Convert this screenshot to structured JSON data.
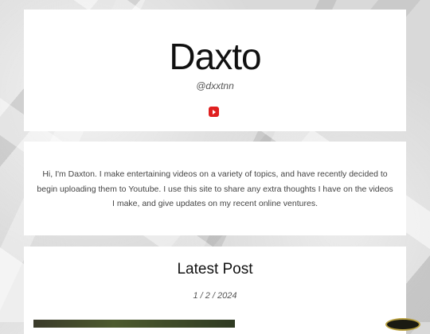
{
  "header": {
    "title": "Daxto",
    "handle": "@dxxtnn",
    "social_icon": "youtube-icon"
  },
  "about": {
    "text": "Hi, I'm Daxton. I make entertaining videos on a variety of topics, and have recently decided to begin uploading them to Youtube. I use this site to share any extra thoughts I have on the videos I make, and give updates on my recent online ventures."
  },
  "latest_post": {
    "heading": "Latest Post",
    "date": "1 / 2 / 2024"
  },
  "colors": {
    "youtube_red": "#e02020",
    "card_background": "#ffffff"
  }
}
